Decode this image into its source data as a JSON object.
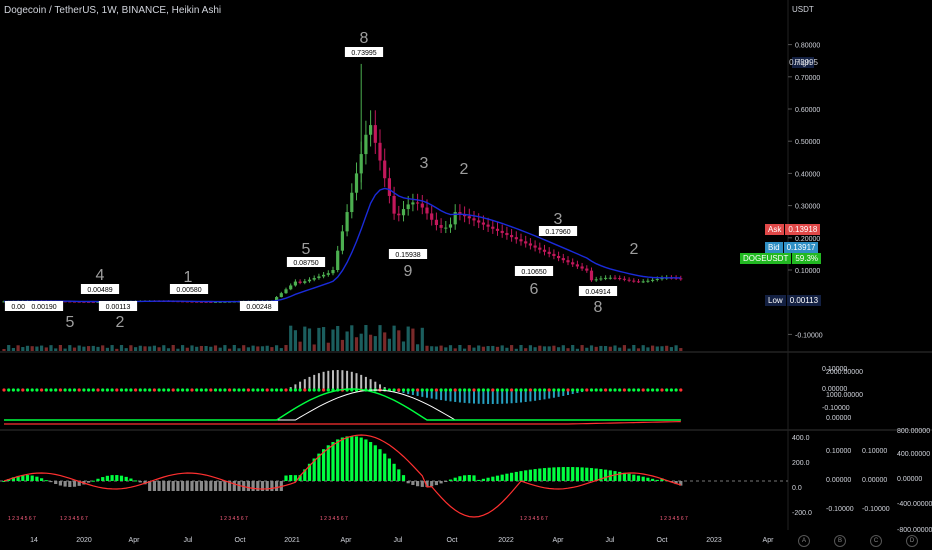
{
  "header": {
    "title": "Dogecoin / TetherUS, 1W, BINANCE, Heikin Ashi",
    "unit": "USDT"
  },
  "colors": {
    "up": "#4caf50",
    "down": "#c2185b",
    "ma": "#1a2bd9",
    "vol_up": "#1b5e5e",
    "vol_down": "#7a2a2a",
    "signal": "#00ff40",
    "slow": "#ffffff",
    "red": "#ff3030"
  },
  "price_tags": {
    "high_label": "High",
    "high_value": "0.73995",
    "ask_label": "Ask",
    "ask_value": "0.13918",
    "bid_label": "Bid",
    "bid_value": "0.13917",
    "symbol_label": "DOGEUSDT",
    "symbol_value": "59.3%",
    "low_label": "Low",
    "low_value": "0.00113"
  },
  "x_ticks": [
    "14",
    "2020",
    "Apr",
    "Jul",
    "Oct",
    "2021",
    "Apr",
    "Jul",
    "Oct",
    "2022",
    "Apr",
    "Jul",
    "Oct",
    "2023",
    "Apr"
  ],
  "footer_icons": [
    "A",
    "B",
    "C",
    "D"
  ],
  "chart_data": [
    {
      "type": "candlestick",
      "title": "Dogecoin / TetherUS, 1W, BINANCE, Heikin Ashi",
      "ylabel": "USDT",
      "y_ticks": [
        "0.80000",
        "0.70000",
        "0.60000",
        "0.50000",
        "0.40000",
        "0.30000",
        "0.20000",
        "0.10000",
        "-0.10000"
      ],
      "ylim": [
        -0.16,
        0.84
      ],
      "high": 0.73995,
      "low": 0.00113,
      "point_labels": [
        {
          "text": "0.00193"
        },
        {
          "text": "0.00190"
        },
        {
          "text": "0.00489"
        },
        {
          "text": "0.00113"
        },
        {
          "text": "0.00580"
        },
        {
          "text": "0.00248"
        },
        {
          "text": "0.08750"
        },
        {
          "text": "0.73995"
        },
        {
          "text": "0.15938"
        },
        {
          "text": "0.17960"
        },
        {
          "text": "0.10650"
        },
        {
          "text": "0.04914"
        }
      ],
      "count_labels": [
        "5",
        "4",
        "2",
        "1",
        "5",
        "8",
        "3",
        "2",
        "9",
        "3",
        "6",
        "8",
        "2"
      ]
    },
    {
      "type": "line",
      "name": "oscillator",
      "y_ticks_left": [
        "0.10000",
        "0.00000",
        "-0.10000"
      ],
      "y_ticks_right": [
        "2000.00000",
        "1000.00000",
        "0.00000"
      ]
    },
    {
      "type": "bar",
      "name": "momentum",
      "y_ticks": [
        "400.0",
        "200.0",
        "0.0",
        "-200.0"
      ],
      "y_ticks_mid": [
        "0.10000",
        "0.00000",
        "-0.10000"
      ],
      "y_ticks_mid2": [
        "0.10000",
        "0.00000",
        "-0.10000"
      ],
      "y_ticks_right": [
        "800.00000",
        "400.00000",
        "0.00000",
        "-400.00000",
        "-800.00000"
      ],
      "sequence_text": "1 2 3 4 5 6 7"
    }
  ]
}
